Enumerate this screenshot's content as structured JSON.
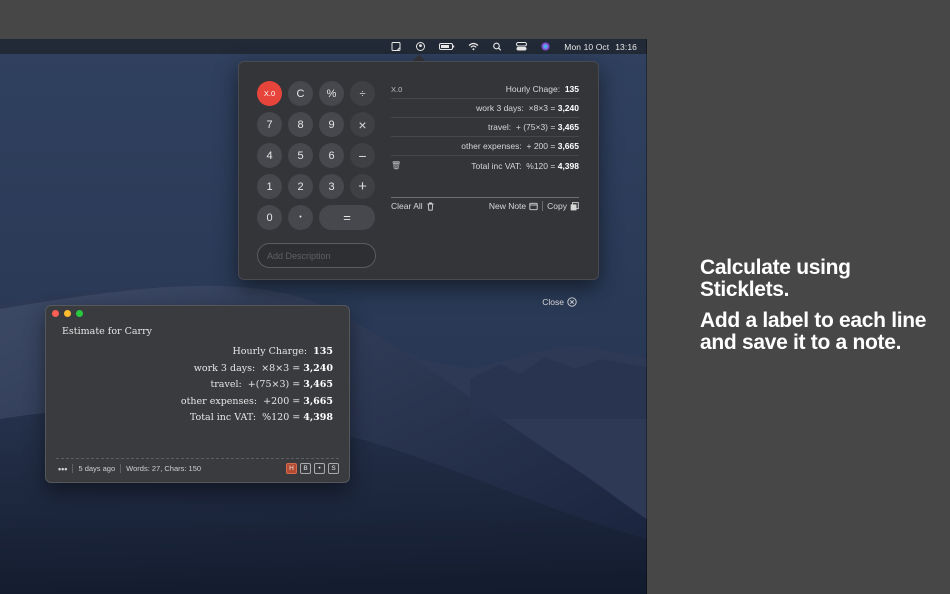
{
  "menubar": {
    "icons": [
      "sticklets-icon",
      "user-icon",
      "battery-icon",
      "wifi-icon",
      "search-icon",
      "control-center-icon",
      "siri-icon"
    ],
    "date": "Mon 10 Oct",
    "time": "13:16"
  },
  "calculator": {
    "keys": {
      "x0": "X.0",
      "clear": "C",
      "percent": "%",
      "divide": "÷",
      "seven": "7",
      "eight": "8",
      "nine": "9",
      "multiply": "×",
      "four": "4",
      "five": "5",
      "six": "6",
      "minus": "−",
      "one": "1",
      "two": "2",
      "three": "3",
      "plus": "+",
      "zero": "0",
      "decimal": "•",
      "equals": "="
    },
    "description_placeholder": "Add Description",
    "tape": [
      {
        "left": "X.0",
        "label": "Hourly Chage:",
        "expr": "",
        "result": "135"
      },
      {
        "left": "",
        "label": "work 3 days:",
        "expr": "×8×3 =",
        "result": "3,240"
      },
      {
        "left": "",
        "label": "travel:",
        "expr": "+ (75×3) =",
        "result": "3,465"
      },
      {
        "left": "",
        "label": "other expenses:",
        "expr": "+ 200 =",
        "result": "3,665"
      },
      {
        "left": "🗑",
        "label": "Total inc VAT:",
        "expr": "%120 =",
        "result": "4,398"
      }
    ],
    "clear_all_label": "Clear All",
    "new_note_label": "New Note",
    "copy_label": "Copy",
    "close_label": "Close"
  },
  "note": {
    "title": "Estimate for Carry",
    "lines": [
      {
        "label": "Hourly Charge:",
        "expr": "",
        "result": "135"
      },
      {
        "label": "work 3 days:",
        "expr": "×8×3 =",
        "result": "3,240"
      },
      {
        "label": "travel:",
        "expr": "+(75×3) =",
        "result": "3,465"
      },
      {
        "label": "other expenses:",
        "expr": "+200 =",
        "result": "3,665"
      },
      {
        "label": "Total inc VAT:",
        "expr": "%120 =",
        "result": "4,398"
      }
    ],
    "footer": {
      "menu": "•••",
      "modified": "5 days ago",
      "stats": "Words: 27, Chars: 150",
      "format_buttons": [
        "H",
        "B",
        "•",
        "S"
      ]
    }
  },
  "promo": {
    "line1": "Calculate using Sticklets.",
    "line2": "Add a label to each line and save it to a note."
  },
  "colors": {
    "accent_red": "#e7443c",
    "background": "#474747",
    "popover": "#333539"
  }
}
